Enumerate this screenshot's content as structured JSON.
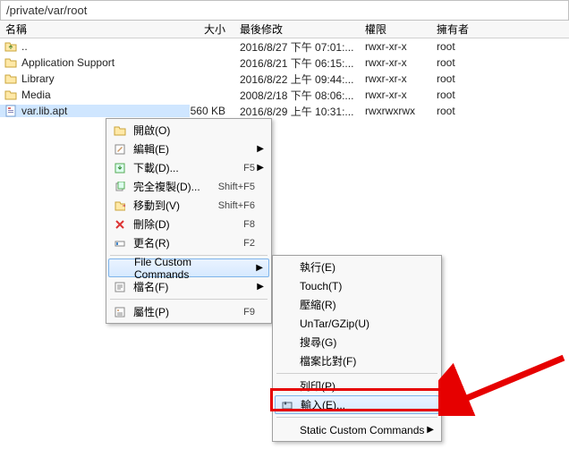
{
  "path": "/private/var/root",
  "columns": {
    "name": "名稱",
    "size": "大小",
    "date": "最後修改",
    "perm": "權限",
    "owner": "擁有者"
  },
  "rows": [
    {
      "name": "..",
      "size": "",
      "date": "2016/8/27 下午 07:01:...",
      "perm": "rwxr-xr-x",
      "owner": "root",
      "type": "up"
    },
    {
      "name": "Application Support",
      "size": "",
      "date": "2016/8/21 下午 06:15:...",
      "perm": "rwxr-xr-x",
      "owner": "root",
      "type": "folder"
    },
    {
      "name": "Library",
      "size": "",
      "date": "2016/8/22 上午 09:44:...",
      "perm": "rwxr-xr-x",
      "owner": "root",
      "type": "folder"
    },
    {
      "name": "Media",
      "size": "",
      "date": "2008/2/18 下午 08:06:...",
      "perm": "rwxr-xr-x",
      "owner": "root",
      "type": "folder"
    },
    {
      "name": "var.lib.apt",
      "size": "560 KB",
      "date": "2016/8/29 上午 10:31:...",
      "perm": "rwxrwxrwx",
      "owner": "root",
      "type": "file",
      "selected": true
    }
  ],
  "menu": [
    {
      "label": "開啟(O)",
      "shortcut": "",
      "arrow": false,
      "icon": "open"
    },
    {
      "label": "編輯(E)",
      "shortcut": "",
      "arrow": true,
      "icon": "edit"
    },
    {
      "label": "下載(D)...",
      "shortcut": "F5",
      "arrow": true,
      "icon": "download"
    },
    {
      "label": "完全複製(D)...",
      "shortcut": "Shift+F5",
      "arrow": false,
      "icon": "copy"
    },
    {
      "label": "移動到(V)",
      "shortcut": "Shift+F6",
      "arrow": false,
      "icon": "move"
    },
    {
      "label": "刪除(D)",
      "shortcut": "F8",
      "arrow": false,
      "icon": "delete"
    },
    {
      "label": "更名(R)",
      "shortcut": "F2",
      "arrow": false,
      "icon": "rename"
    },
    {
      "sep": true
    },
    {
      "label": "File Custom Commands",
      "shortcut": "",
      "arrow": true,
      "icon": "",
      "highlight": true
    },
    {
      "label": "檔名(F)",
      "shortcut": "",
      "arrow": true,
      "icon": "filename"
    },
    {
      "sep": true
    },
    {
      "label": "屬性(P)",
      "shortcut": "F9",
      "arrow": false,
      "icon": "props"
    }
  ],
  "submenu": [
    {
      "label": "執行(E)"
    },
    {
      "label": "Touch(T)"
    },
    {
      "label": "壓縮(R)"
    },
    {
      "label": "UnTar/GZip(U)"
    },
    {
      "label": "搜尋(G)"
    },
    {
      "label": "檔案比對(F)"
    },
    {
      "sep": true
    },
    {
      "label": "列印(P)"
    },
    {
      "label": "輸入(E)...",
      "highlight": true,
      "icon": "input"
    },
    {
      "sep": true
    },
    {
      "label": "Static Custom Commands",
      "arrow": true
    }
  ]
}
